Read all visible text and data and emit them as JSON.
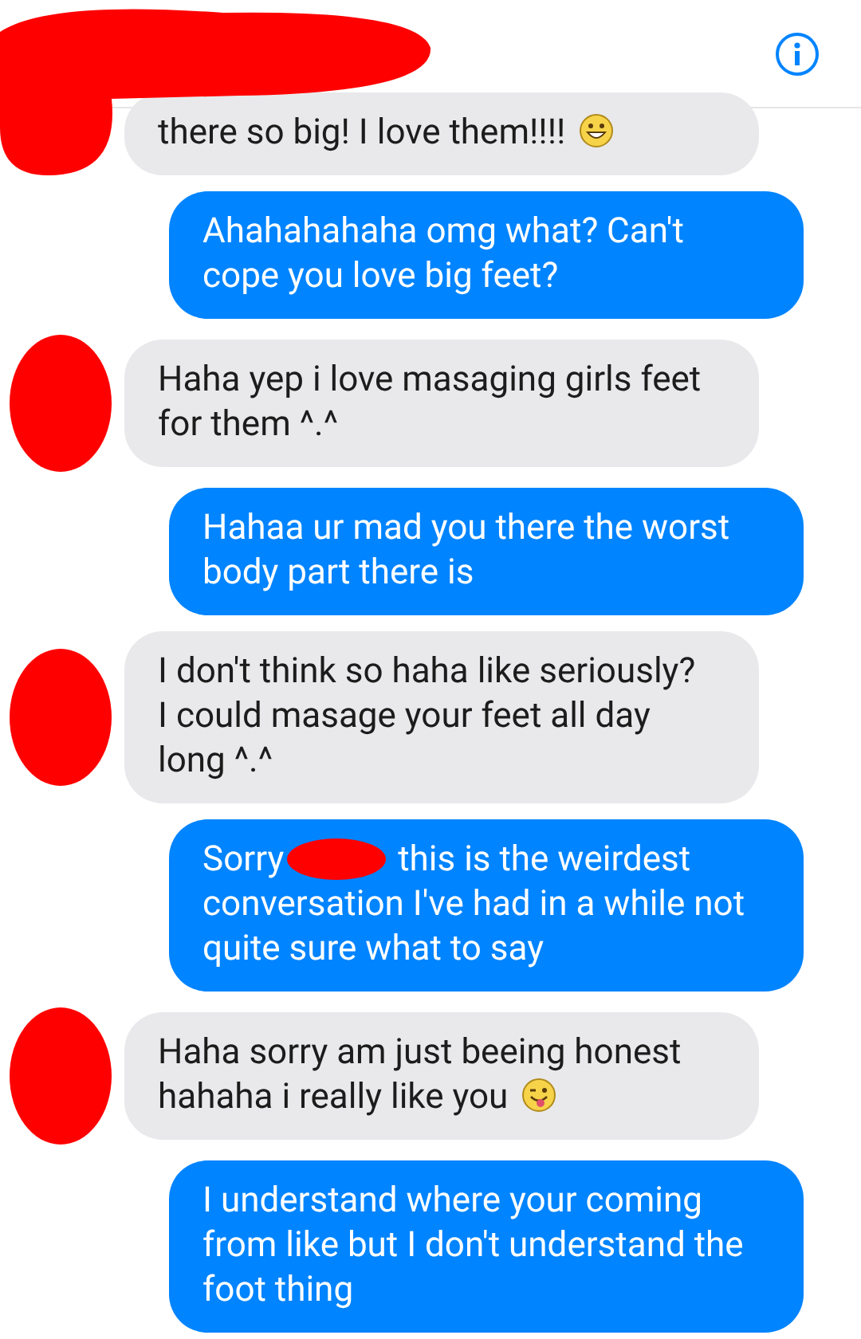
{
  "header": {
    "header_redacted": true
  },
  "messages": [
    {
      "kind": "incoming",
      "text": "there so big! I love them!!!!",
      "emoji": {
        "kind": "grin"
      }
    },
    {
      "kind": "outgoing",
      "text": "Ahahahahaha omg what? Can't cope you love big feet?"
    },
    {
      "kind": "incoming",
      "text": "Haha yep i love masaging girls feet for them ^.^",
      "avatar_redacted": true
    },
    {
      "kind": "outgoing",
      "text": "Hahaa ur mad you there the worst body part there is"
    },
    {
      "kind": "incoming",
      "text": "I don't think so haha like seriously? I could masage your feet all day long ^.^",
      "avatar_redacted": true
    },
    {
      "kind": "outgoing",
      "prefix": "Sorry",
      "name_redacted": true,
      "text": "this is the weirdest conversation I've had in a while not quite sure what to say"
    },
    {
      "kind": "incoming",
      "text": "Haha sorry am just beeing honest hahaha i really like you",
      "emoji": {
        "kind": "tongue"
      },
      "avatar_redacted": true
    },
    {
      "kind": "outgoing",
      "text": "I understand where your coming from like but I don't understand the foot thing"
    }
  ]
}
